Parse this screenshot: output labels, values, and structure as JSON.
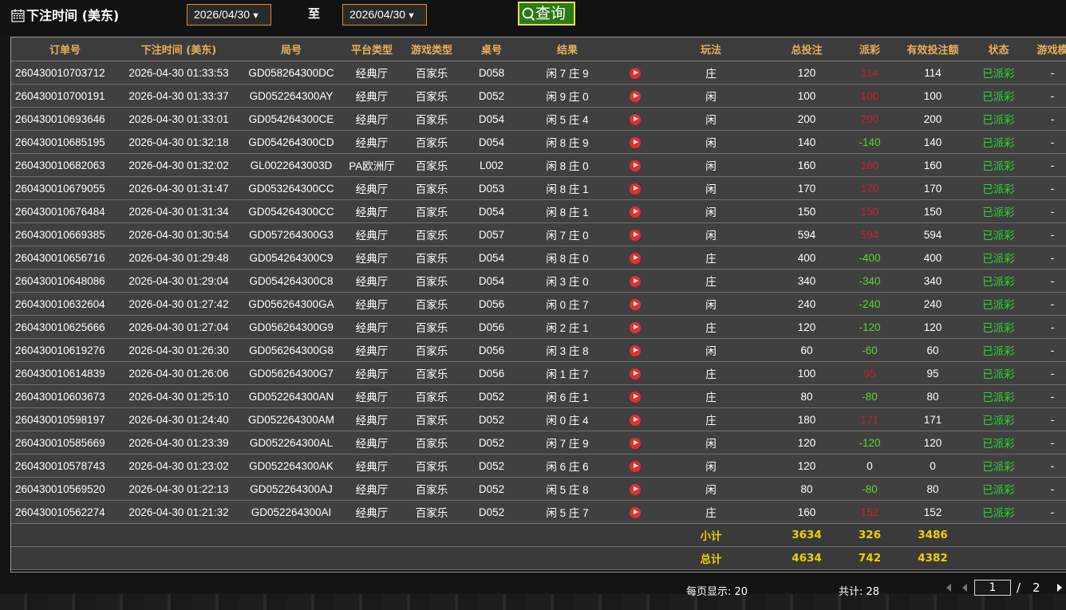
{
  "filter": {
    "label": "下注时间 (美东)",
    "start_date": "2026/04/30",
    "to_label": "至",
    "end_date": "2026/04/30",
    "query_label": "查询"
  },
  "table": {
    "headers": [
      "订单号",
      "下注时间 (美东)",
      "局号",
      "平台类型",
      "游戏类型",
      "桌号",
      "结果",
      "",
      "玩法",
      "总投注",
      "派彩",
      "有效投注额",
      "状态",
      "游戏模"
    ],
    "rows": [
      {
        "order": "260430010703712",
        "time": "2026-04-30 01:33:53",
        "round": "GD058264300DC",
        "platform": "经典厅",
        "game": "百家乐",
        "table": "D058",
        "result": "闲 7 庄 9",
        "play": "庄",
        "bet": "120",
        "payout": "114",
        "payout_color": "red",
        "valid": "114",
        "status": "已派彩",
        "mode": "-"
      },
      {
        "order": "260430010700191",
        "time": "2026-04-30 01:33:37",
        "round": "GD052264300AY",
        "platform": "经典厅",
        "game": "百家乐",
        "table": "D052",
        "result": "闲 9 庄 0",
        "play": "闲",
        "bet": "100",
        "payout": "100",
        "payout_color": "red",
        "valid": "100",
        "status": "已派彩",
        "mode": "-"
      },
      {
        "order": "260430010693646",
        "time": "2026-04-30 01:33:01",
        "round": "GD054264300CE",
        "platform": "经典厅",
        "game": "百家乐",
        "table": "D054",
        "result": "闲 5 庄 4",
        "play": "闲",
        "bet": "200",
        "payout": "200",
        "payout_color": "red",
        "valid": "200",
        "status": "已派彩",
        "mode": "-"
      },
      {
        "order": "260430010685195",
        "time": "2026-04-30 01:32:18",
        "round": "GD054264300CD",
        "platform": "经典厅",
        "game": "百家乐",
        "table": "D054",
        "result": "闲 8 庄 9",
        "play": "闲",
        "bet": "140",
        "payout": "-140",
        "payout_color": "green",
        "valid": "140",
        "status": "已派彩",
        "mode": "-"
      },
      {
        "order": "260430010682063",
        "time": "2026-04-30 01:32:02",
        "round": "GL0022643003D",
        "platform": "PA欧洲厅",
        "game": "百家乐",
        "table": "L002",
        "result": "闲 8 庄 0",
        "play": "闲",
        "bet": "160",
        "payout": "160",
        "payout_color": "red",
        "valid": "160",
        "status": "已派彩",
        "mode": "-"
      },
      {
        "order": "260430010679055",
        "time": "2026-04-30 01:31:47",
        "round": "GD053264300CC",
        "platform": "经典厅",
        "game": "百家乐",
        "table": "D053",
        "result": "闲 8 庄 1",
        "play": "闲",
        "bet": "170",
        "payout": "170",
        "payout_color": "red",
        "valid": "170",
        "status": "已派彩",
        "mode": "-"
      },
      {
        "order": "260430010676484",
        "time": "2026-04-30 01:31:34",
        "round": "GD054264300CC",
        "platform": "经典厅",
        "game": "百家乐",
        "table": "D054",
        "result": "闲 8 庄 1",
        "play": "闲",
        "bet": "150",
        "payout": "150",
        "payout_color": "red",
        "valid": "150",
        "status": "已派彩",
        "mode": "-"
      },
      {
        "order": "260430010669385",
        "time": "2026-04-30 01:30:54",
        "round": "GD057264300G3",
        "platform": "经典厅",
        "game": "百家乐",
        "table": "D057",
        "result": "闲 7 庄 0",
        "play": "闲",
        "bet": "594",
        "payout": "594",
        "payout_color": "red",
        "valid": "594",
        "status": "已派彩",
        "mode": "-"
      },
      {
        "order": "260430010656716",
        "time": "2026-04-30 01:29:48",
        "round": "GD054264300C9",
        "platform": "经典厅",
        "game": "百家乐",
        "table": "D054",
        "result": "闲 8 庄 0",
        "play": "庄",
        "bet": "400",
        "payout": "-400",
        "payout_color": "green",
        "valid": "400",
        "status": "已派彩",
        "mode": "-"
      },
      {
        "order": "260430010648086",
        "time": "2026-04-30 01:29:04",
        "round": "GD054264300C8",
        "platform": "经典厅",
        "game": "百家乐",
        "table": "D054",
        "result": "闲 3 庄 0",
        "play": "庄",
        "bet": "340",
        "payout": "-340",
        "payout_color": "green",
        "valid": "340",
        "status": "已派彩",
        "mode": "-"
      },
      {
        "order": "260430010632604",
        "time": "2026-04-30 01:27:42",
        "round": "GD056264300GA",
        "platform": "经典厅",
        "game": "百家乐",
        "table": "D056",
        "result": "闲 0 庄 7",
        "play": "闲",
        "bet": "240",
        "payout": "-240",
        "payout_color": "green",
        "valid": "240",
        "status": "已派彩",
        "mode": "-"
      },
      {
        "order": "260430010625666",
        "time": "2026-04-30 01:27:04",
        "round": "GD056264300G9",
        "platform": "经典厅",
        "game": "百家乐",
        "table": "D056",
        "result": "闲 2 庄 1",
        "play": "庄",
        "bet": "120",
        "payout": "-120",
        "payout_color": "green",
        "valid": "120",
        "status": "已派彩",
        "mode": "-"
      },
      {
        "order": "260430010619276",
        "time": "2026-04-30 01:26:30",
        "round": "GD056264300G8",
        "platform": "经典厅",
        "game": "百家乐",
        "table": "D056",
        "result": "闲 3 庄 8",
        "play": "闲",
        "bet": "60",
        "payout": "-60",
        "payout_color": "green",
        "valid": "60",
        "status": "已派彩",
        "mode": "-"
      },
      {
        "order": "260430010614839",
        "time": "2026-04-30 01:26:06",
        "round": "GD056264300G7",
        "platform": "经典厅",
        "game": "百家乐",
        "table": "D056",
        "result": "闲 1 庄 7",
        "play": "庄",
        "bet": "100",
        "payout": "95",
        "payout_color": "red",
        "valid": "95",
        "status": "已派彩",
        "mode": "-"
      },
      {
        "order": "260430010603673",
        "time": "2026-04-30 01:25:10",
        "round": "GD052264300AN",
        "platform": "经典厅",
        "game": "百家乐",
        "table": "D052",
        "result": "闲 6 庄 1",
        "play": "庄",
        "bet": "80",
        "payout": "-80",
        "payout_color": "green",
        "valid": "80",
        "status": "已派彩",
        "mode": "-"
      },
      {
        "order": "260430010598197",
        "time": "2026-04-30 01:24:40",
        "round": "GD052264300AM",
        "platform": "经典厅",
        "game": "百家乐",
        "table": "D052",
        "result": "闲 0 庄 4",
        "play": "庄",
        "bet": "180",
        "payout": "171",
        "payout_color": "red",
        "valid": "171",
        "status": "已派彩",
        "mode": "-"
      },
      {
        "order": "260430010585669",
        "time": "2026-04-30 01:23:39",
        "round": "GD052264300AL",
        "platform": "经典厅",
        "game": "百家乐",
        "table": "D052",
        "result": "闲 7 庄 9",
        "play": "闲",
        "bet": "120",
        "payout": "-120",
        "payout_color": "green",
        "valid": "120",
        "status": "已派彩",
        "mode": "-"
      },
      {
        "order": "260430010578743",
        "time": "2026-04-30 01:23:02",
        "round": "GD052264300AK",
        "platform": "经典厅",
        "game": "百家乐",
        "table": "D052",
        "result": "闲 6 庄 6",
        "play": "闲",
        "bet": "120",
        "payout": "0",
        "payout_color": "white",
        "valid": "0",
        "status": "已派彩",
        "mode": "-"
      },
      {
        "order": "260430010569520",
        "time": "2026-04-30 01:22:13",
        "round": "GD052264300AJ",
        "platform": "经典厅",
        "game": "百家乐",
        "table": "D052",
        "result": "闲 5 庄 8",
        "play": "闲",
        "bet": "80",
        "payout": "-80",
        "payout_color": "green",
        "valid": "80",
        "status": "已派彩",
        "mode": "-"
      },
      {
        "order": "260430010562274",
        "time": "2026-04-30 01:21:32",
        "round": "GD052264300AI",
        "platform": "经典厅",
        "game": "百家乐",
        "table": "D052",
        "result": "闲 5 庄 7",
        "play": "庄",
        "bet": "160",
        "payout": "152",
        "payout_color": "red",
        "valid": "152",
        "status": "已派彩",
        "mode": "-"
      }
    ],
    "subtotal": {
      "label": "小计",
      "bet": "3634",
      "payout": "326",
      "valid": "3486"
    },
    "total": {
      "label": "总计",
      "bet": "4634",
      "payout": "742",
      "valid": "4382"
    }
  },
  "colors": {
    "header_text": "#e7b05a",
    "payout_red": "#c8202e",
    "payout_green": "#5bd72a",
    "status_green": "#29d82e",
    "sum_yellow": "#f0d000",
    "date_border": "#d8902a"
  },
  "icons": {
    "calendar": "calendar-icon",
    "search": "search-icon",
    "video": "play-video-icon"
  },
  "pagination": {
    "per_page_label": "每页显示: 20",
    "total_label": "共计: 28",
    "current_page": "1",
    "separator": "/",
    "total_pages": "2"
  }
}
